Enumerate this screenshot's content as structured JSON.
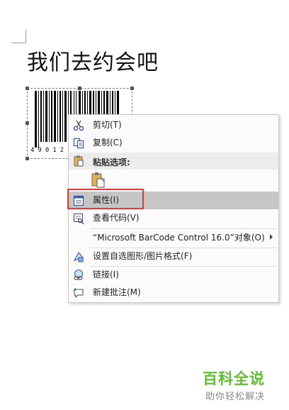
{
  "document": {
    "heading": "我们去约会吧"
  },
  "barcode": {
    "digits": "4901231"
  },
  "context_menu": {
    "items": [
      {
        "label": "剪切(T)",
        "icon": "scissors-icon"
      },
      {
        "label": "复制(C)",
        "icon": "copy-icon"
      },
      {
        "label": "粘贴选项:",
        "icon": "clipboard-icon"
      },
      {
        "label": "",
        "icon": "paste-option-icon"
      },
      {
        "label": "属性(I)",
        "icon": "properties-icon"
      },
      {
        "label": "查看代码(V)",
        "icon": "view-code-icon"
      },
      {
        "label": "“Microsoft BarCode Control 16.0”对象(O)",
        "icon": ""
      },
      {
        "label": "设置自选图形/图片格式(F)",
        "icon": "format-shape-icon"
      },
      {
        "label": "链接(I)",
        "icon": "link-icon"
      },
      {
        "label": "新建批注(M)",
        "icon": "comment-icon"
      }
    ]
  },
  "watermark": {
    "main": "百科全说",
    "sub": "助你轻松解决"
  },
  "colors": {
    "highlight": "#c6c6c6",
    "callout_border": "#e53935",
    "watermark_green": "#5fbf2f"
  }
}
